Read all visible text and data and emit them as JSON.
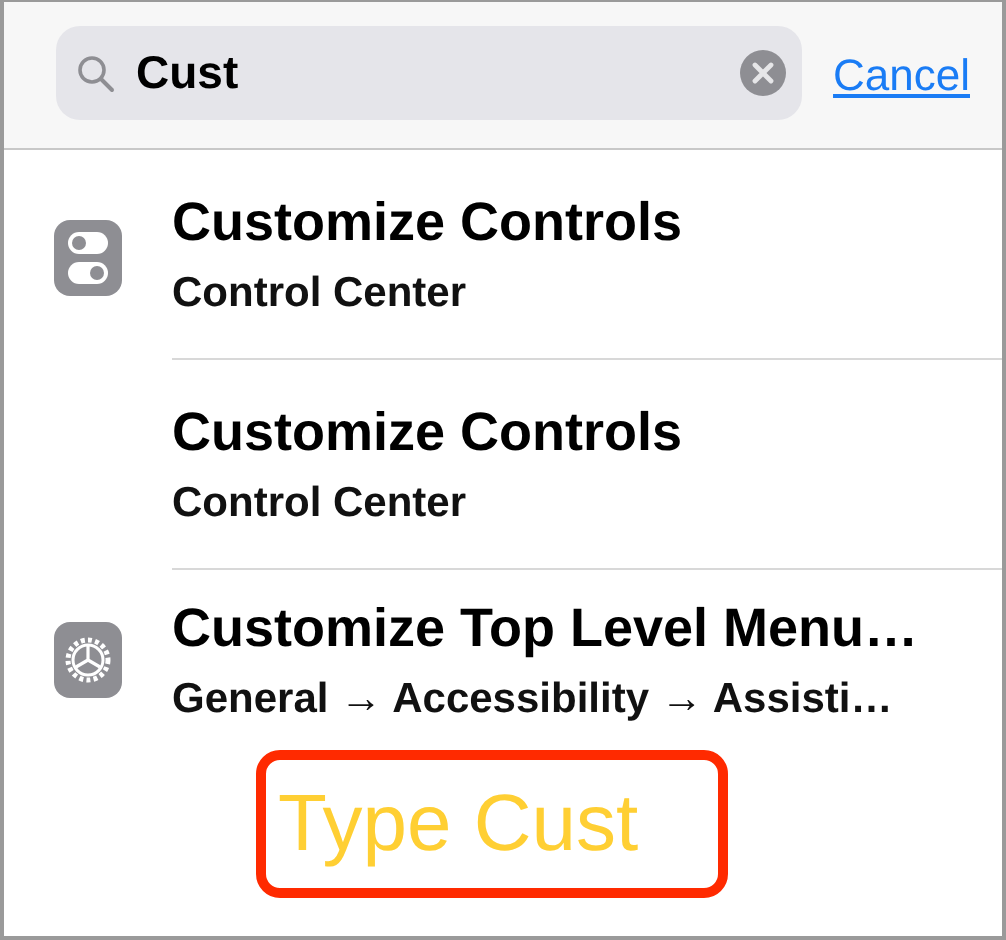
{
  "search": {
    "value": "Cust",
    "cancel": "Cancel"
  },
  "results": [
    {
      "title": "Customize Controls",
      "subtitle": "Control Center",
      "kind": "toggles"
    },
    {
      "title": "Customize Controls",
      "subtitle": "Control Center",
      "kind": "plain"
    },
    {
      "title": "Customize Top Level Menu…",
      "subtitle": "General → Accessibility → Assisti…",
      "kind": "gear"
    }
  ],
  "annotation": {
    "text": "Type Cust"
  }
}
